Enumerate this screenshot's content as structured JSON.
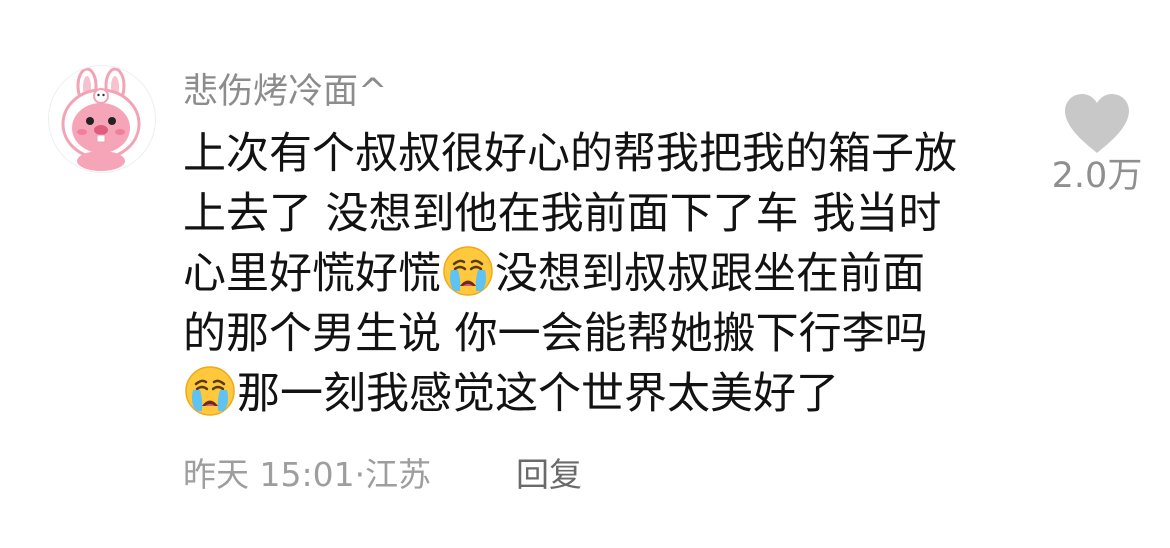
{
  "comment": {
    "username": "悲伤烤冷面^",
    "lines": [
      {
        "text_before": "上次有个叔叔很好心的帮我把我的箱子放"
      },
      {
        "text_before": "上去了 没想到他在我前面下了车 我当时"
      },
      {
        "text_before": "心里好慌好慌",
        "emoji": "crying-face",
        "text_after": "没想到叔叔跟坐在前面"
      },
      {
        "text_before": "的那个男生说 你一会能帮她搬下行李吗"
      },
      {
        "text_before": "",
        "emoji": "crying-face",
        "text_after": "那一刻我感觉这个世界太美好了"
      }
    ],
    "timestamp": "昨天 15:01",
    "separator": "·",
    "location": "江苏",
    "reply_label": "回复",
    "like_count": "2.0万",
    "icons": {
      "avatar": "bunny-hood-beaver-avatar",
      "like": "heart-icon",
      "emoji": "loudly-crying-face-emoji"
    },
    "colors": {
      "username": "#8c8c8c",
      "text": "#121212",
      "meta": "#9e9e9e",
      "heart": "#c8c8c8"
    }
  }
}
